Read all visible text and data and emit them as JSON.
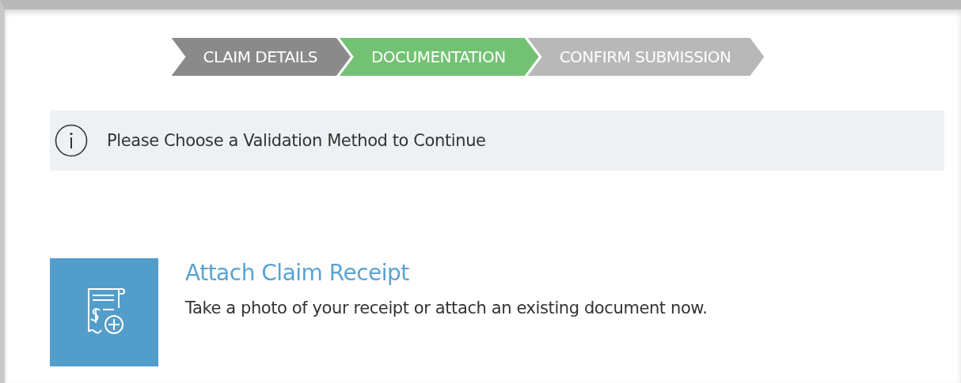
{
  "steps": [
    {
      "label": "CLAIM DETAILS",
      "kind": "completed"
    },
    {
      "label": "DOCUMENTATION",
      "kind": "active"
    },
    {
      "label": "CONFIRM SUBMISSION",
      "kind": "upcoming"
    }
  ],
  "notice": {
    "text": "Please Choose a Validation Method to Continue"
  },
  "options": [
    {
      "title": "Attach Claim Receipt",
      "description": "Take a photo of your receipt or attach an existing document now."
    }
  ]
}
